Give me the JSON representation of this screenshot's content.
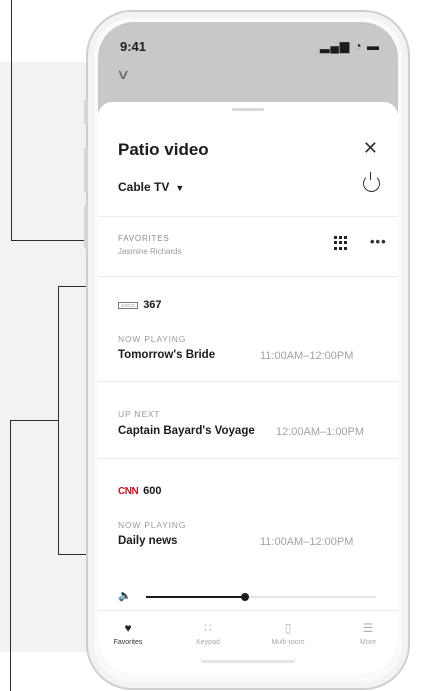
{
  "status_bar": {
    "time": "9:41",
    "icons": "▂▄▆ ◔ ▬",
    "icon_names": [
      "signal-icon",
      "wifi-icon",
      "battery-icon"
    ]
  },
  "header": {
    "collapse_icon": "chevron-down-icon",
    "collapse_glyph": "∨",
    "room_title": "Patio video",
    "close_glyph": "✕",
    "source_label": "Cable TV",
    "source_caret": "▼"
  },
  "favorites": {
    "label": "FAVORITES",
    "user": "Jasmine Richards",
    "more_glyph": "•••"
  },
  "channels": [
    {
      "logo_text": "▭▭▭",
      "number": "367",
      "now_playing_label": "NOW PLAYING",
      "now_title": "Tomorrow's Bride",
      "now_time": "11:00AM–12:00PM",
      "up_next_label": "UP NEXT",
      "next_title": "Captain Bayard's Voyage",
      "next_time": "12:00AM–1:00PM"
    },
    {
      "logo_text": "CNN",
      "number": "600",
      "now_playing_label": "NOW PLAYING",
      "now_title": "Daily news",
      "now_time": "11:00AM–12:00PM"
    }
  ],
  "volume": {
    "icon_glyph": "🔈",
    "level": 0.43
  },
  "tabs": [
    {
      "label": "Favorites",
      "icon": "heart-icon",
      "glyph": "♥",
      "active": true
    },
    {
      "label": "Keypad",
      "icon": "keypad-icon",
      "glyph": "∷",
      "active": false
    },
    {
      "label": "Multi-room",
      "icon": "multi-room-icon",
      "glyph": "▯",
      "active": false
    },
    {
      "label": "More",
      "icon": "sliders-icon",
      "glyph": "☰",
      "active": false
    }
  ],
  "colors": {
    "accent": "#1b1b1b",
    "cnn_red": "#c1121f",
    "muted_text": "#a3a3a3"
  }
}
